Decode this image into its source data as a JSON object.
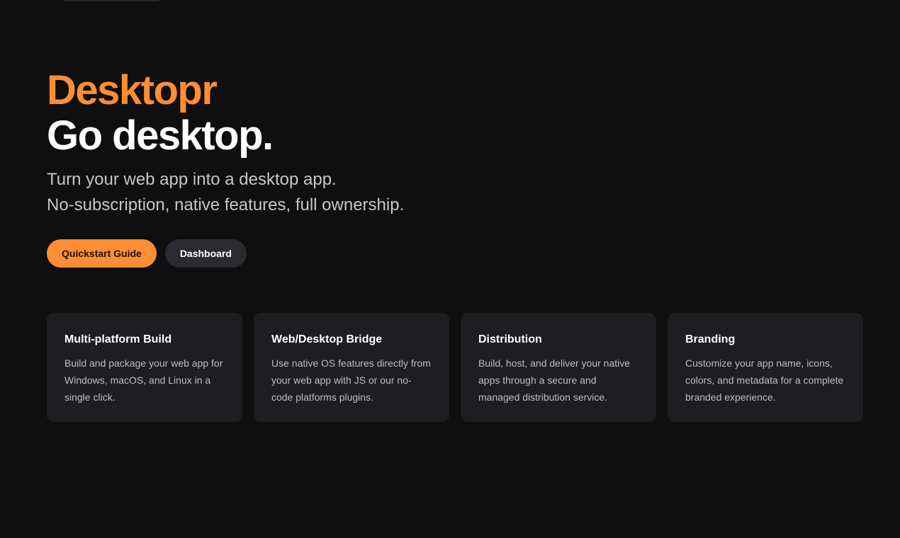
{
  "theme": {
    "accent": "#ff8d33",
    "background": "#0f0f10",
    "card_background": "#1d1d22",
    "secondary_button": "#2a2b31"
  },
  "hero": {
    "brand": "Desktopr",
    "headline": "Go desktop.",
    "subtitle_lines": [
      "Turn your web app into a desktop app.",
      "No-subscription, native features, full ownership."
    ]
  },
  "actions": {
    "quickstart_label": "Quickstart Guide",
    "dashboard_label": "Dashboard"
  },
  "features": [
    {
      "title": "Multi-platform Build",
      "description": "Build and package your web app for Windows, macOS, and Linux in a single click."
    },
    {
      "title": "Web/Desktop Bridge",
      "description": "Use native OS features directly from your web app with JS or our no-code platforms plugins."
    },
    {
      "title": "Distribution",
      "description": "Build, host, and deliver your native apps through a secure and managed distribution service."
    },
    {
      "title": "Branding",
      "description": "Customize your app name, icons, colors, and metadata for a complete branded experience."
    }
  ]
}
